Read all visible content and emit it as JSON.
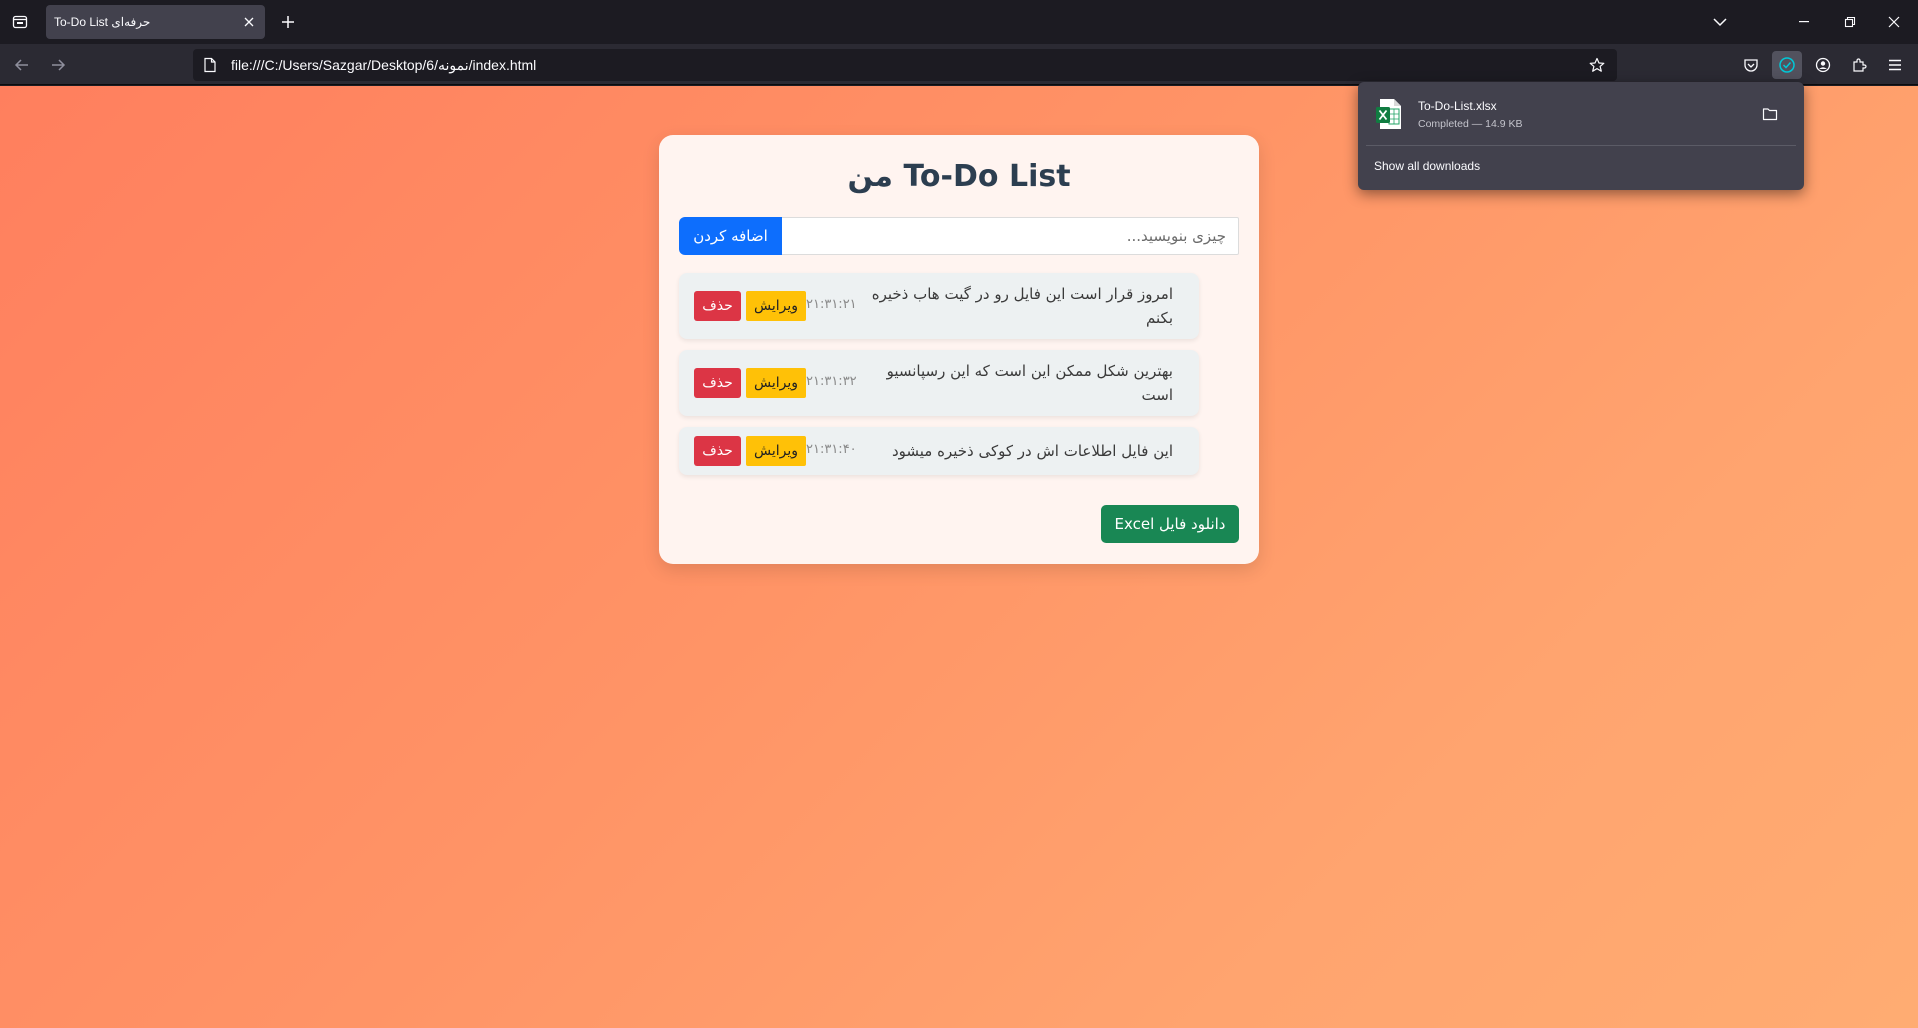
{
  "browser": {
    "tab": {
      "title": "To-Do List حرفه‌ای"
    },
    "url": "file:///C:/Users/Sazgar/Desktop/6/نمونه/index.html",
    "accent_color": "#00c8d7"
  },
  "downloads": {
    "file_name": "To-Do-List.xlsx",
    "status": "Completed — 14.9 KB",
    "show_all": "Show all downloads"
  },
  "app": {
    "title": "To-Do List من",
    "input_placeholder": "چیزی بنویسید...",
    "add_label": "اضافه کردن",
    "edit_label": "ویرایش",
    "delete_label": "حذف",
    "excel_label": "دانلود فایل Excel",
    "colors": {
      "add": "#0d6efd",
      "edit": "#ffc107",
      "delete": "#dc3545",
      "excel": "#198754",
      "title": "#2c3e50"
    },
    "todos": [
      {
        "text": "امروز قرار است این فایل رو در گیت هاب ذخیره بکنم",
        "time": "۲۱:۳۱:۲۱"
      },
      {
        "text": "بهترین شکل ممکن این است که این رسپانسیو است",
        "time": "۲۱:۳۱:۳۲"
      },
      {
        "text": "این فایل اطلاعات اش در کوکی ذخیره میشود",
        "time": "۲۱:۳۱:۴۰"
      }
    ]
  }
}
